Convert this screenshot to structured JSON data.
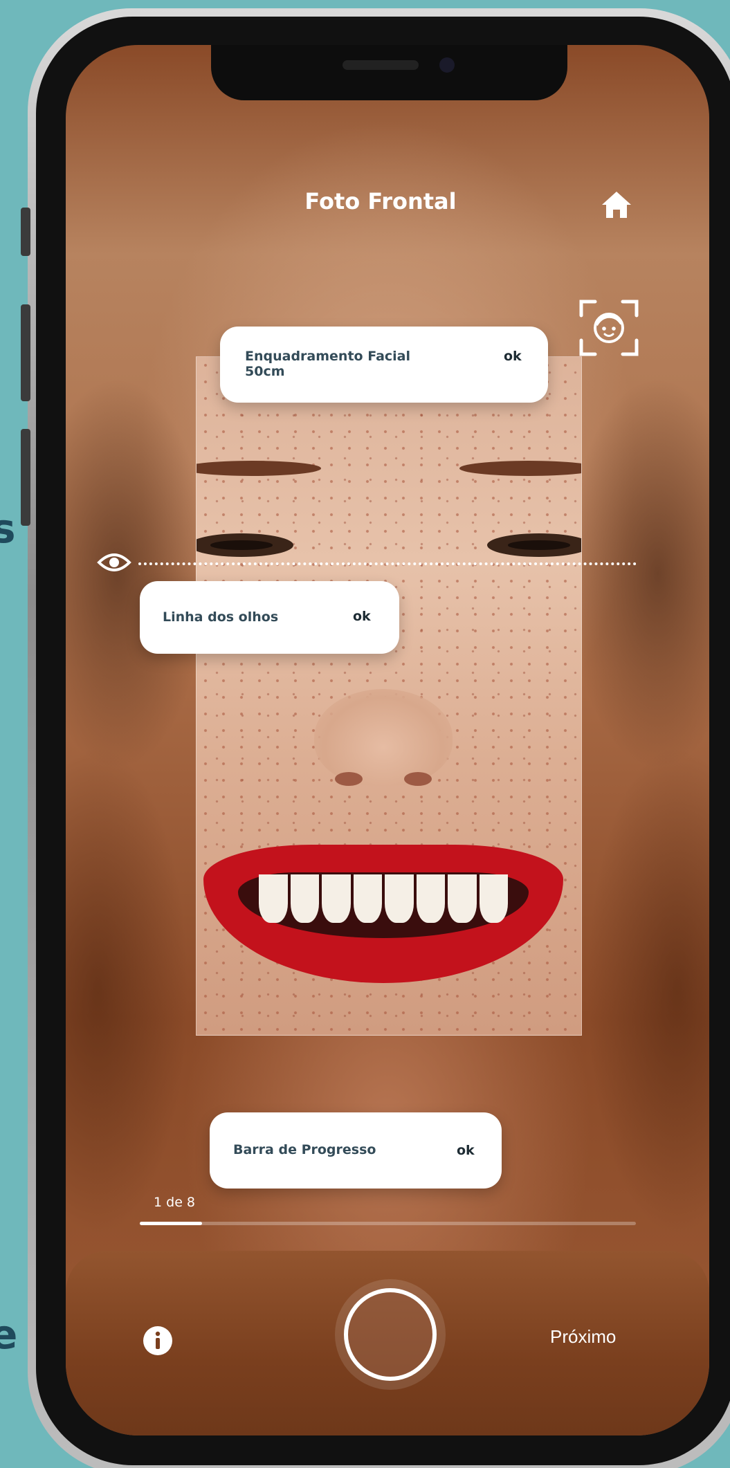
{
  "screen": {
    "title": "Foto Frontal"
  },
  "badges": {
    "face_framing": {
      "label_line1": "Enquadramento Facial",
      "label_line2": "50cm",
      "status": "ok"
    },
    "eye_line": {
      "label": "Linha dos olhos",
      "status": "ok"
    },
    "progress_bar": {
      "label": "Barra de Progresso",
      "status": "ok"
    }
  },
  "progress": {
    "text": "1 de 8",
    "current": 1,
    "total": 8
  },
  "bottom_bar": {
    "next_label": "Próximo"
  },
  "edge_glyphs": [
    "s",
    "e"
  ],
  "icons": {
    "home": "home-icon",
    "face_frame": "face-frame-icon",
    "eye": "eye-icon",
    "info": "info-icon",
    "shutter": "shutter-icon"
  },
  "colors": {
    "background": "#6fb8bb",
    "pill_text": "#334b58",
    "ok_text": "#1d2b33",
    "lip_red": "#c3121c"
  }
}
